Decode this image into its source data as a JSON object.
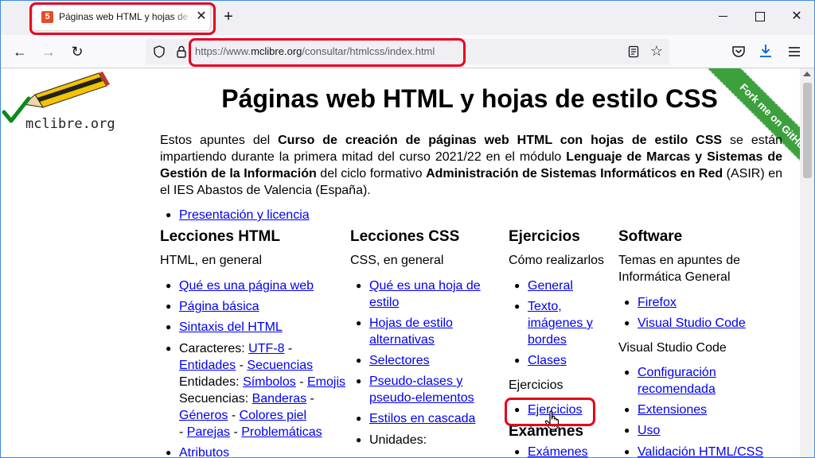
{
  "browser": {
    "tab_title": "Páginas web HTML y hojas de estilo CSS",
    "url_prefix": "https://www.",
    "url_domain": "mclibre.org",
    "url_path": "/consultar/htmlcss/index.html",
    "colors": {
      "highlight": "#e8001c",
      "link": "#0000ee",
      "ribbon": "#3ca13c"
    }
  },
  "page": {
    "logo_text": "mclibre.org",
    "ribbon_text": "Fork me on GitHub",
    "title": "Páginas web HTML y hojas de estilo CSS",
    "intro": {
      "t1": "Estos apuntes del ",
      "b1": "Curso de creación de páginas web HTML con hojas de estilo CSS",
      "t2": " se están impartiendo durante la primera mitad del curso 2021/22 en el módulo ",
      "b2": "Lenguaje de Marcas y Sistemas de Gestión de la Información",
      "t3": " del ciclo formativo ",
      "b3": "Administración de Sistemas Informáticos en Red",
      "t4": " (ASIR) en el IES Abastos de Valencia (España)."
    },
    "presentacion_link": "Presentación y licencia",
    "html_col": {
      "heading": "Lecciones HTML",
      "subheading": "HTML, en general",
      "items": [
        "Qué es una página web",
        "Página básica",
        "Sintaxis del HTML"
      ],
      "caracteres_label": "Caracteres: ",
      "utf8": "UTF-8",
      "entidades": "Entidades",
      "secuencias": "Secuencias",
      "entidades_label": "Entidades: ",
      "simbolos": "Símbolos",
      "emojis": "Emojis",
      "secuencias_label": "Secuencias: ",
      "banderas": "Banderas",
      "generos": "Géneros",
      "colores_piel": "Colores piel",
      "parejas": "Parejas",
      "problematicas": "Problemáticas",
      "sep": " - ",
      "atributos": "Atributos"
    },
    "css_col": {
      "heading": "Lecciones CSS",
      "subheading": "CSS, en general",
      "item1a": "Qué es una hoja de",
      "item1b": "estilo",
      "item2a": "Hojas de estilo",
      "item2b": "alternativas",
      "item3": "Selectores",
      "item4a": "Pseudo-clases y",
      "item4b": "pseudo-elementos",
      "item5": "Estilos en cascada",
      "item6": "Unidades:"
    },
    "ej_col": {
      "heading": "Ejercicios",
      "subheading": "Cómo realizarlos",
      "item1": "General",
      "item2a": "Texto,",
      "item2b": "imágenes y",
      "item2c": "bordes",
      "item3": "Clases",
      "subheading2": "Ejercicios",
      "item4": "Ejercicios",
      "heading2": "Exámenes",
      "item5": "Exámenes"
    },
    "sw_col": {
      "heading": "Software",
      "sub1a": "Temas en apuntes de",
      "sub1b": "Informática General",
      "item1": "Firefox",
      "item2": "Visual Studio Code",
      "sub2": "Visual Studio Code",
      "item3a": "Configuración",
      "item3b": "recomendada",
      "item4": "Extensiones",
      "item5": "Uso",
      "item6": "Validación HTML/CSS"
    }
  }
}
